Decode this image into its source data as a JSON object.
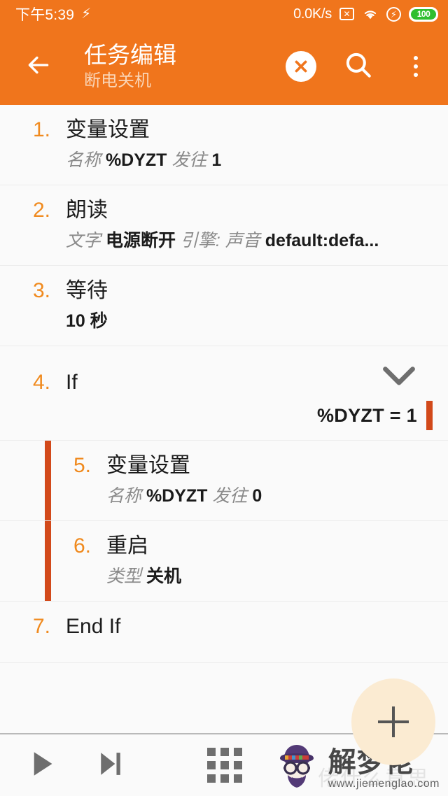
{
  "status_bar": {
    "time": "下午5:39",
    "charging_icon": "bolt-icon",
    "network_speed": "0.0K/s",
    "icons": [
      "no-sim-icon",
      "wifi-icon",
      "flash-circle-icon",
      "battery-icon"
    ],
    "battery_level": "100",
    "background_color": "#F0751C"
  },
  "app_bar": {
    "back_icon": "back-arrow-icon",
    "title": "任务编辑",
    "subtitle": "断电关机",
    "actions": [
      {
        "name": "close-button",
        "icon": "close-x-icon"
      },
      {
        "name": "search-button",
        "icon": "search-icon"
      },
      {
        "name": "overflow-button",
        "icon": "more-vertical-icon"
      }
    ],
    "background_color": "#F0751C",
    "title_color": "#FFFFFF",
    "subtitle_color": "#FAD5B6"
  },
  "accent_colors": {
    "primary_orange": "#F0751C",
    "number_orange": "#F08A1E",
    "indent_bar": "#D2491A",
    "list_background": "#FAFAFA",
    "divider": "#ECECEC"
  },
  "actions": [
    {
      "number": "1.",
      "title": "变量设置",
      "sub_parts": [
        {
          "text": "名称 ",
          "bold": false
        },
        {
          "text": "%DYZT",
          "bold": true
        },
        {
          "text": " 发往 ",
          "bold": false
        },
        {
          "text": "1",
          "bold": true
        }
      ],
      "indented": false
    },
    {
      "number": "2.",
      "title": "朗读",
      "sub_parts": [
        {
          "text": "文字 ",
          "bold": false
        },
        {
          "text": "电源断开",
          "bold": true
        },
        {
          "text": " 引擎: 声音 ",
          "bold": false
        },
        {
          "text": "default:defa...",
          "bold": true
        }
      ],
      "indented": false
    },
    {
      "number": "3.",
      "title": "等待",
      "sub_parts": [
        {
          "text": "10 秒",
          "bold": true
        }
      ],
      "indented": false
    },
    {
      "number": "4.",
      "title": "If",
      "condition": "%DYZT = 1",
      "collapse_icon": "chevron-down-icon",
      "indented": false,
      "is_if": true
    },
    {
      "number": "5.",
      "title": "变量设置",
      "sub_parts": [
        {
          "text": "名称 ",
          "bold": false
        },
        {
          "text": "%DYZT",
          "bold": true
        },
        {
          "text": " 发往 ",
          "bold": false
        },
        {
          "text": "0",
          "bold": true
        }
      ],
      "indented": true
    },
    {
      "number": "6.",
      "title": "重启",
      "sub_parts": [
        {
          "text": "类型 ",
          "bold": false
        },
        {
          "text": "关机",
          "bold": true
        }
      ],
      "indented": true
    },
    {
      "number": "7.",
      "title": "End If",
      "sub_parts": [],
      "indented": false
    }
  ],
  "bottom_bar": {
    "buttons": [
      {
        "name": "play-button",
        "icon": "play-icon"
      },
      {
        "name": "step-button",
        "icon": "step-forward-icon"
      },
      {
        "name": "grid-button",
        "icon": "grid-apps-icon"
      }
    ],
    "fab": {
      "name": "add-action-fab",
      "icon": "plus-icon",
      "color": "#FBEBD2"
    }
  },
  "watermark": {
    "logo": "bearded-face-icon",
    "title": "解梦佬",
    "url": "www.jiemenglao.com",
    "ghost_text": "佬什么意思"
  }
}
